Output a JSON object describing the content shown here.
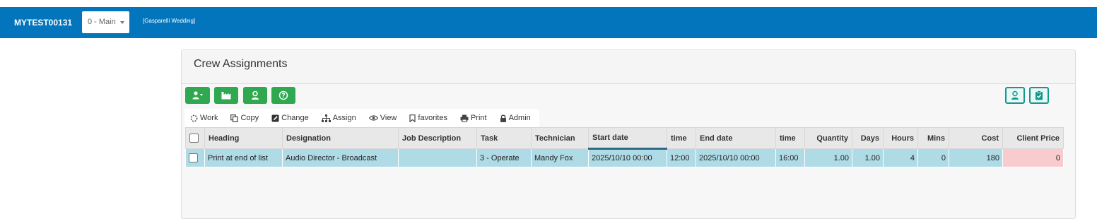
{
  "header": {
    "job_number": "MYTEST00131",
    "version_select": "0 - Main",
    "job_name": "[Gasparelli Wedding]"
  },
  "panel": {
    "title": "Crew Assignments"
  },
  "toolbar": {
    "green_buttons": [
      "add-crew-icon",
      "warehouse-icon",
      "technician-icon",
      "help-icon"
    ],
    "right_buttons": [
      "technician-icon",
      "clipboard-check-icon"
    ]
  },
  "menu": {
    "work": "Work",
    "copy": "Copy",
    "change": "Change",
    "assign": "Assign",
    "view": "View",
    "favorites": "favorites",
    "print": "Print",
    "admin": "Admin"
  },
  "table": {
    "headers": {
      "heading": "Heading",
      "designation": "Designation",
      "job_description": "Job Description",
      "task": "Task",
      "technician": "Technician",
      "start_date": "Start date",
      "start_time": "time",
      "end_date": "End date",
      "end_time": "time",
      "quantity": "Quantity",
      "days": "Days",
      "hours": "Hours",
      "mins": "Mins",
      "cost": "Cost",
      "client_price": "Client Price"
    },
    "rows": [
      {
        "heading": "Print at end of list",
        "designation": "Audio Director - Broadcast",
        "job_description": "",
        "task": "3 - Operate",
        "technician": "Mandy Fox",
        "start_date": "2025/10/10 00:00",
        "start_time": "12:00",
        "end_date": "2025/10/10 00:00",
        "end_time": "16:00",
        "quantity": "1.00",
        "days": "1.00",
        "hours": "4",
        "mins": "0",
        "cost": "180",
        "client_price": "0"
      }
    ]
  },
  "colors": {
    "topbar": "#0275bd",
    "action_green": "#2fa84f",
    "row_blue": "#afdbe6",
    "price_pink": "#f8cccf",
    "outline_teal": "#11998e"
  }
}
